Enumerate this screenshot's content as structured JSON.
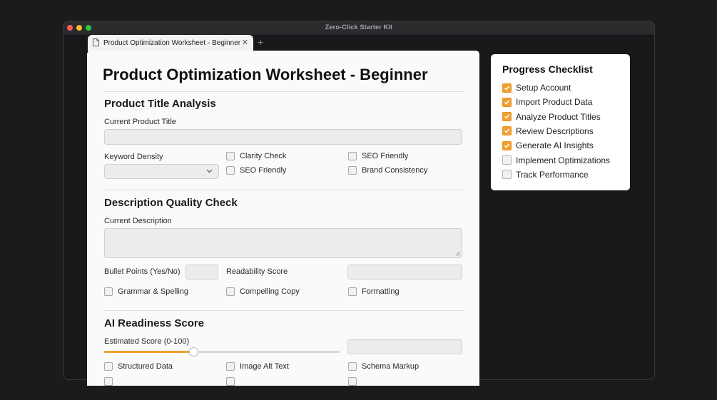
{
  "window": {
    "title": "Zero-Click Starter Kit",
    "tab_label": "Product Optimization Worksheet - Beginner",
    "tab_close": "✕",
    "new_tab": "+"
  },
  "worksheet": {
    "title": "Product Optimization Worksheet - Beginner",
    "product_title_section": {
      "heading": "Product Title Analysis",
      "current_title_label": "Current Product Title",
      "current_title_value": "",
      "keyword_density_label": "Keyword Density",
      "keyword_density_value": "",
      "checkboxes": [
        {
          "label": "Clarity Check",
          "checked": false
        },
        {
          "label": "SEO Friendly",
          "checked": false
        },
        {
          "label": "SEO Friendly",
          "checked": false
        },
        {
          "label": "Brand Consistency",
          "checked": false
        }
      ]
    },
    "description_section": {
      "heading": "Description Quality Check",
      "current_description_label": "Current Description",
      "current_description_value": "",
      "bullet_points_label": "Bullet Points (Yes/No)",
      "bullet_points_value": "",
      "readability_label": "Readability Score",
      "readability_value": "",
      "checkboxes": [
        {
          "label": "Grammar & Spelling",
          "checked": false
        },
        {
          "label": "Compelling Copy",
          "checked": false
        },
        {
          "label": "Formatting",
          "checked": false
        }
      ]
    },
    "ai_section": {
      "heading": "AI Readiness Score",
      "estimated_score_label": "Estimated Score (0-100)",
      "estimated_score_slider_fraction": 0.38,
      "estimated_score_value": "",
      "checkboxes": [
        {
          "label": "Structured Data",
          "checked": false
        },
        {
          "label": "Image Alt Text",
          "checked": false
        },
        {
          "label": "Schema Markup",
          "checked": false
        }
      ]
    }
  },
  "progress_checklist": {
    "title": "Progress Checklist",
    "items": [
      {
        "label": "Setup Account",
        "checked": true
      },
      {
        "label": "Import Product Data",
        "checked": true
      },
      {
        "label": "Analyze Product Titles",
        "checked": true
      },
      {
        "label": "Review Descriptions",
        "checked": true
      },
      {
        "label": "Generate AI Insights",
        "checked": true
      },
      {
        "label": "Implement Optimizations",
        "checked": false
      },
      {
        "label": "Track Performance",
        "checked": false
      }
    ]
  },
  "colors": {
    "accent": "#f0a032",
    "background": "#1b1b1d",
    "panel": "#fafafa"
  }
}
